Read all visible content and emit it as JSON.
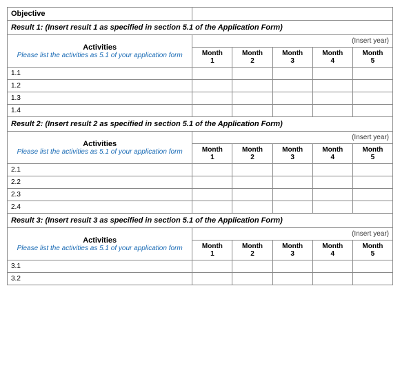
{
  "table": {
    "objective_label": "Objective",
    "insert_year": "(Insert year)",
    "activities_label": "Activities",
    "activities_italic": "Please list the activities as 5.1 of your application form",
    "months": [
      {
        "label": "Month",
        "num": "1"
      },
      {
        "label": "Month",
        "num": "2"
      },
      {
        "label": "Month",
        "num": "3"
      },
      {
        "label": "Month",
        "num": "4"
      },
      {
        "label": "Month",
        "num": "5"
      }
    ],
    "result1": {
      "label": "Result 1:  (Insert result 1 as  specified in section 5.1 of the Application Form)",
      "rows": [
        "1.1",
        "1.2",
        "1.3",
        "1.4"
      ]
    },
    "result2": {
      "label": "Result 2:  (Insert result 2 as specified in section 5.1 of the Application Form)",
      "rows": [
        "2.1",
        "2.2",
        "2.3",
        "2.4"
      ]
    },
    "result3": {
      "label": "Result 3:  (Insert result 3 as specified in section 5.1 of the Application Form)",
      "rows": [
        "3.1",
        "3.2"
      ]
    }
  }
}
